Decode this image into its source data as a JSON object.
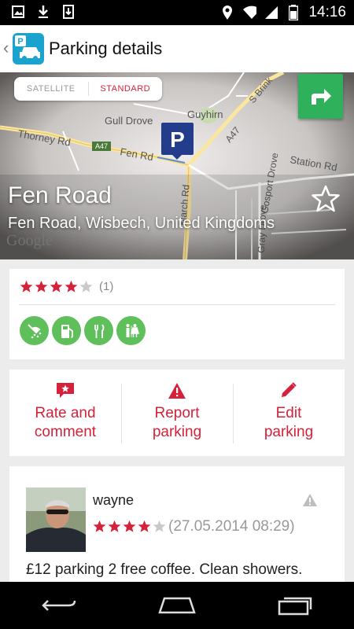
{
  "status_bar": {
    "time": "14:16"
  },
  "header": {
    "title": "Parking details"
  },
  "map": {
    "toggle": {
      "satellite": "SATELLITE",
      "standard": "STANDARD"
    },
    "labels": [
      "Gull Drove",
      "Guyhirn",
      "Thorney Rd",
      "A47",
      "Fen Rd",
      "S Brink",
      "A47",
      "Station Rd",
      "Gosport Drove",
      "March Rd",
      "Gray Drove"
    ],
    "google": "Google",
    "parking_marker": "P"
  },
  "place": {
    "name": "Fen Road",
    "address": "Fen Road, Wisbech, United Kingdoms"
  },
  "rating": {
    "stars": 4,
    "max": 5,
    "count": "(1)"
  },
  "amenities": [
    "shower-icon",
    "fuel-icon",
    "restaurant-icon",
    "toilet-icon"
  ],
  "actions": [
    {
      "label_line1": "Rate and",
      "label_line2": "comment"
    },
    {
      "label_line1": "Report",
      "label_line2": "parking"
    },
    {
      "label_line1": "Edit",
      "label_line2": "parking"
    }
  ],
  "review": {
    "author": "wayne",
    "stars": 4,
    "date": "(27.05.2014 08:29)",
    "text": "£12 parking 2 free coffee. Clean showers."
  },
  "colors": {
    "accent": "#d6213a",
    "green": "#2fb15b",
    "amenity": "#5fbf5b",
    "brand": "#1aa3cf"
  }
}
